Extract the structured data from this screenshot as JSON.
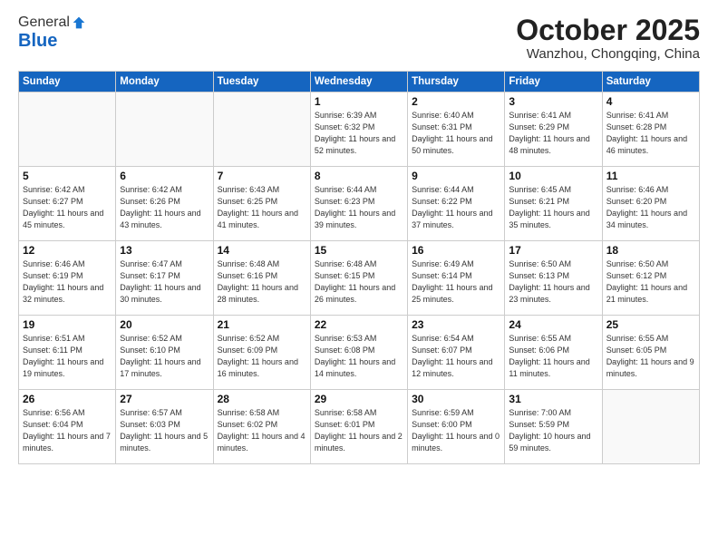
{
  "header": {
    "logo_general": "General",
    "logo_blue": "Blue",
    "month_title": "October 2025",
    "location": "Wanzhou, Chongqing, China"
  },
  "weekdays": [
    "Sunday",
    "Monday",
    "Tuesday",
    "Wednesday",
    "Thursday",
    "Friday",
    "Saturday"
  ],
  "weeks": [
    [
      {
        "day": "",
        "info": ""
      },
      {
        "day": "",
        "info": ""
      },
      {
        "day": "",
        "info": ""
      },
      {
        "day": "1",
        "info": "Sunrise: 6:39 AM\nSunset: 6:32 PM\nDaylight: 11 hours\nand 52 minutes."
      },
      {
        "day": "2",
        "info": "Sunrise: 6:40 AM\nSunset: 6:31 PM\nDaylight: 11 hours\nand 50 minutes."
      },
      {
        "day": "3",
        "info": "Sunrise: 6:41 AM\nSunset: 6:29 PM\nDaylight: 11 hours\nand 48 minutes."
      },
      {
        "day": "4",
        "info": "Sunrise: 6:41 AM\nSunset: 6:28 PM\nDaylight: 11 hours\nand 46 minutes."
      }
    ],
    [
      {
        "day": "5",
        "info": "Sunrise: 6:42 AM\nSunset: 6:27 PM\nDaylight: 11 hours\nand 45 minutes."
      },
      {
        "day": "6",
        "info": "Sunrise: 6:42 AM\nSunset: 6:26 PM\nDaylight: 11 hours\nand 43 minutes."
      },
      {
        "day": "7",
        "info": "Sunrise: 6:43 AM\nSunset: 6:25 PM\nDaylight: 11 hours\nand 41 minutes."
      },
      {
        "day": "8",
        "info": "Sunrise: 6:44 AM\nSunset: 6:23 PM\nDaylight: 11 hours\nand 39 minutes."
      },
      {
        "day": "9",
        "info": "Sunrise: 6:44 AM\nSunset: 6:22 PM\nDaylight: 11 hours\nand 37 minutes."
      },
      {
        "day": "10",
        "info": "Sunrise: 6:45 AM\nSunset: 6:21 PM\nDaylight: 11 hours\nand 35 minutes."
      },
      {
        "day": "11",
        "info": "Sunrise: 6:46 AM\nSunset: 6:20 PM\nDaylight: 11 hours\nand 34 minutes."
      }
    ],
    [
      {
        "day": "12",
        "info": "Sunrise: 6:46 AM\nSunset: 6:19 PM\nDaylight: 11 hours\nand 32 minutes."
      },
      {
        "day": "13",
        "info": "Sunrise: 6:47 AM\nSunset: 6:17 PM\nDaylight: 11 hours\nand 30 minutes."
      },
      {
        "day": "14",
        "info": "Sunrise: 6:48 AM\nSunset: 6:16 PM\nDaylight: 11 hours\nand 28 minutes."
      },
      {
        "day": "15",
        "info": "Sunrise: 6:48 AM\nSunset: 6:15 PM\nDaylight: 11 hours\nand 26 minutes."
      },
      {
        "day": "16",
        "info": "Sunrise: 6:49 AM\nSunset: 6:14 PM\nDaylight: 11 hours\nand 25 minutes."
      },
      {
        "day": "17",
        "info": "Sunrise: 6:50 AM\nSunset: 6:13 PM\nDaylight: 11 hours\nand 23 minutes."
      },
      {
        "day": "18",
        "info": "Sunrise: 6:50 AM\nSunset: 6:12 PM\nDaylight: 11 hours\nand 21 minutes."
      }
    ],
    [
      {
        "day": "19",
        "info": "Sunrise: 6:51 AM\nSunset: 6:11 PM\nDaylight: 11 hours\nand 19 minutes."
      },
      {
        "day": "20",
        "info": "Sunrise: 6:52 AM\nSunset: 6:10 PM\nDaylight: 11 hours\nand 17 minutes."
      },
      {
        "day": "21",
        "info": "Sunrise: 6:52 AM\nSunset: 6:09 PM\nDaylight: 11 hours\nand 16 minutes."
      },
      {
        "day": "22",
        "info": "Sunrise: 6:53 AM\nSunset: 6:08 PM\nDaylight: 11 hours\nand 14 minutes."
      },
      {
        "day": "23",
        "info": "Sunrise: 6:54 AM\nSunset: 6:07 PM\nDaylight: 11 hours\nand 12 minutes."
      },
      {
        "day": "24",
        "info": "Sunrise: 6:55 AM\nSunset: 6:06 PM\nDaylight: 11 hours\nand 11 minutes."
      },
      {
        "day": "25",
        "info": "Sunrise: 6:55 AM\nSunset: 6:05 PM\nDaylight: 11 hours\nand 9 minutes."
      }
    ],
    [
      {
        "day": "26",
        "info": "Sunrise: 6:56 AM\nSunset: 6:04 PM\nDaylight: 11 hours\nand 7 minutes."
      },
      {
        "day": "27",
        "info": "Sunrise: 6:57 AM\nSunset: 6:03 PM\nDaylight: 11 hours\nand 5 minutes."
      },
      {
        "day": "28",
        "info": "Sunrise: 6:58 AM\nSunset: 6:02 PM\nDaylight: 11 hours\nand 4 minutes."
      },
      {
        "day": "29",
        "info": "Sunrise: 6:58 AM\nSunset: 6:01 PM\nDaylight: 11 hours\nand 2 minutes."
      },
      {
        "day": "30",
        "info": "Sunrise: 6:59 AM\nSunset: 6:00 PM\nDaylight: 11 hours\nand 0 minutes."
      },
      {
        "day": "31",
        "info": "Sunrise: 7:00 AM\nSunset: 5:59 PM\nDaylight: 10 hours\nand 59 minutes."
      },
      {
        "day": "",
        "info": ""
      }
    ]
  ]
}
